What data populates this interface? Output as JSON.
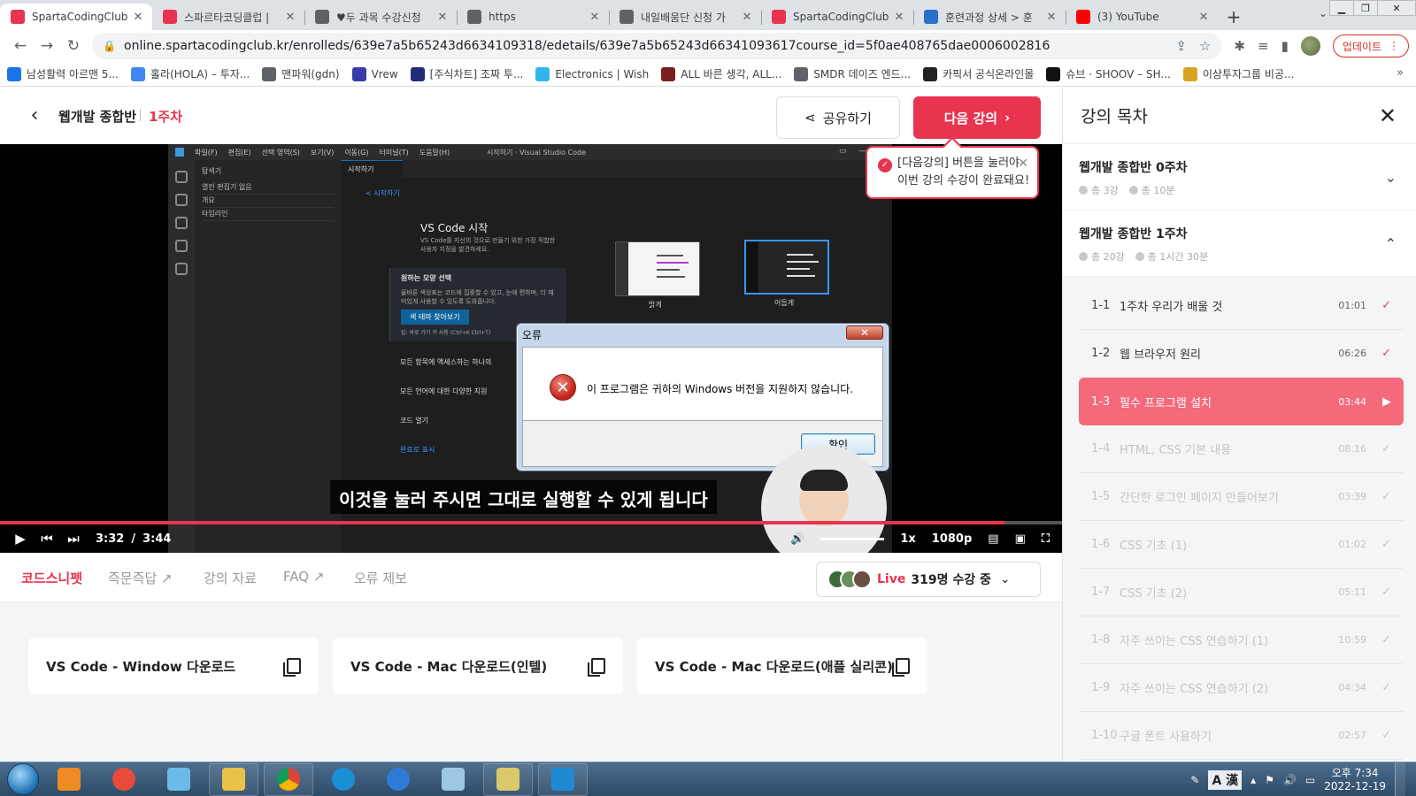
{
  "browser": {
    "tabs": [
      {
        "title": "SpartaCodingClub",
        "fav_color": "#e8344e",
        "active": true
      },
      {
        "title": "스파르타코딩클럽 | ",
        "fav_color": "#e8344e",
        "active": false
      },
      {
        "title": "♥두 과목 수강신청 ",
        "fav_color": "#5f6368",
        "active": false
      },
      {
        "title": "https",
        "fav_color": "#5f6368",
        "active": false
      },
      {
        "title": "내일배움단 신청 가",
        "fav_color": "#5f6368",
        "active": false
      },
      {
        "title": "SpartaCodingClub",
        "fav_color": "#e8344e",
        "active": false
      },
      {
        "title": "훈련과정 상세 > 훈",
        "fav_color": "#2a6fc9",
        "active": false
      },
      {
        "title": "(3) YouTube",
        "fav_color": "#ff0000",
        "active": false
      }
    ],
    "url": "online.spartacodingclub.kr/enrolleds/639e7a5b65243d6634109318/edetails/639e7a5b65243d66341093617course_id=5f0ae408765dae0006002816",
    "update_label": "업데이트",
    "bookmarks": [
      {
        "label": "남성활력 아르맨 5...",
        "color": "#1a73e8"
      },
      {
        "label": "홀라(HOLA) – 투자...",
        "color": "#4285f4"
      },
      {
        "label": "맨파워(gdn)",
        "color": "#5f6368"
      },
      {
        "label": "Vrew",
        "color": "#3a3aa8"
      },
      {
        "label": "[주식차트] 조짜 투...",
        "color": "#1f2d7a"
      },
      {
        "label": "Electronics | Wish",
        "color": "#2fb7ec"
      },
      {
        "label": "ALL 바른 생각, ALL...",
        "color": "#7a1f1f"
      },
      {
        "label": "SMDR 데이즈 엔드...",
        "color": "#5f6368"
      },
      {
        "label": "카픽서 공식온라인몰",
        "color": "#222222"
      },
      {
        "label": "슈브 · SHOOV – SH...",
        "color": "#111111"
      },
      {
        "label": "이상투자그룹 비공...",
        "color": "#d9a520"
      }
    ]
  },
  "header": {
    "course_title": "웹개발 종합반",
    "week": "1주차",
    "share_label": "공유하기",
    "next_label": "다음 강의"
  },
  "toast": {
    "line1": "[다음강의] 버튼을 눌러야",
    "line2": "이번 강의 수강이 완료돼요!"
  },
  "video": {
    "vscode": {
      "menus": [
        "파일(F)",
        "편집(E)",
        "선택 영역(S)",
        "보기(V)",
        "이동(G)",
        "터미널(T)",
        "도움말(H)"
      ],
      "window_title": "시작하기 · Visual Studio Code",
      "sidebar_header": "탐색기",
      "sidebar_rows": [
        "열린 편집기 없음",
        "개요",
        "타임라인"
      ],
      "tab": "시작하기",
      "back_link": "< 시작하기",
      "heading": "VS Code 시작",
      "heading_sub": "VS Code를 자신의 것으로 만들기 위한 가장 적합한 사용자 지정을 발견하세요.",
      "step1": "원하는 모양 선택",
      "step1_desc": "올바른 색상표는 코드에 집중할 수 있고, 눈에 편하며, 더 재미있게 사용할 수 있도록 도와줍니다.",
      "step1_button": "색 테마 찾아보기",
      "step1_hint": "팁: 바로 가기 키 사용 (Ctrl+K Ctrl+T)",
      "step2": "모든 항목에 액세스하는 하나의",
      "step3": "모든 언어에 대한 다양한 지원",
      "step4": "코드 열기",
      "done": "완료로 표시",
      "theme_light": "밝게",
      "theme_dark": "어둡게"
    },
    "error_dialog": {
      "title": "오류",
      "message": "이 프로그램은 귀하의 Windows 버전을 지원하지 않습니다.",
      "ok_label": "확인"
    },
    "subtitle": "이것을 눌러 주시면 그대로 실행할 수 있게 됩니다",
    "current_time": "3:32",
    "separator": "/",
    "duration": "3:44",
    "progress": 0.946,
    "speed": "1x",
    "quality": "1080p"
  },
  "lower_tabs": [
    "코드스니펫",
    "즉문즉답",
    "강의 자료",
    "FAQ",
    "오류 제보"
  ],
  "live": {
    "label": "Live",
    "viewers": "319명 수강 중"
  },
  "snippets": [
    "VS Code - Window 다운로드",
    "VS Code - Mac 다운로드(인텔)",
    "VS Code - Mac 다운로드(애플 실리콘)"
  ],
  "toc": {
    "title": "강의 목차",
    "weeks": [
      {
        "name": "웹개발 종합반 0주차",
        "count": "총 3강",
        "time": "총 10분",
        "expanded": false
      },
      {
        "name": "웹개발 종합반 1주차",
        "count": "총 20강",
        "time": "총 1시간 30분",
        "expanded": true
      }
    ],
    "lessons": [
      {
        "num": "1-1",
        "name": "1주차 우리가 배울 것",
        "dur": "01:01",
        "state": "done"
      },
      {
        "num": "1-2",
        "name": "웹 브라우저 원리",
        "dur": "06:26",
        "state": "done"
      },
      {
        "num": "1-3",
        "name": "필수 프로그램 설치",
        "dur": "03:44",
        "state": "current"
      },
      {
        "num": "1-4",
        "name": "HTML, CSS 기본 내용",
        "dur": "08:16",
        "state": "locked"
      },
      {
        "num": "1-5",
        "name": "간단한 로그인 페이지 만들어보기",
        "dur": "03:39",
        "state": "locked"
      },
      {
        "num": "1-6",
        "name": "CSS 기초 (1)",
        "dur": "01:02",
        "state": "locked"
      },
      {
        "num": "1-7",
        "name": "CSS 기초 (2)",
        "dur": "05:11",
        "state": "locked"
      },
      {
        "num": "1-8",
        "name": "자주 쓰이는 CSS 연습하기 (1)",
        "dur": "10:59",
        "state": "locked"
      },
      {
        "num": "1-9",
        "name": "자주 쓰이는 CSS 연습하기 (2)",
        "dur": "04:34",
        "state": "locked"
      },
      {
        "num": "1-10",
        "name": "구글 폰트 사용하기",
        "dur": "02:57",
        "state": "locked"
      }
    ]
  },
  "taskbar": {
    "clock_time": "오후 7:34",
    "clock_date": "2022-12-19",
    "ime_label": "A 漢"
  },
  "colors": {
    "accent": "#e8344e"
  }
}
